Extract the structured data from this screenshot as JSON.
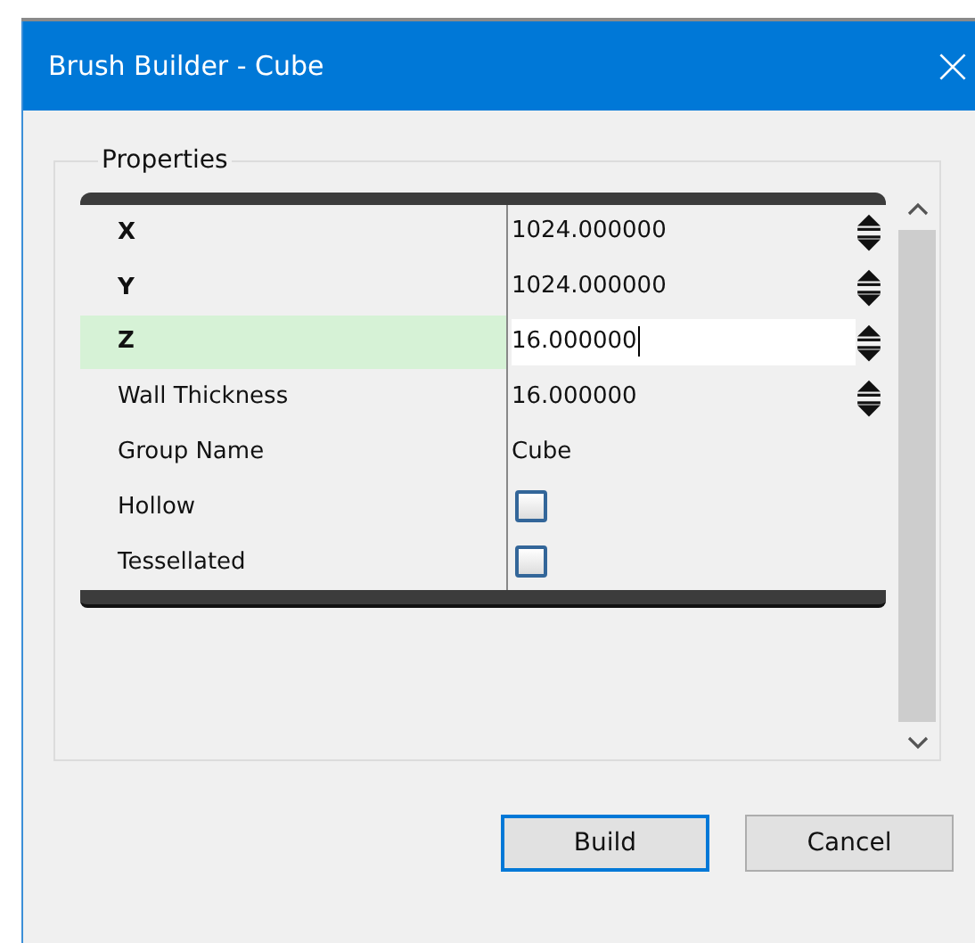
{
  "window": {
    "title": "Brush Builder - Cube"
  },
  "group": {
    "label": "Properties"
  },
  "properties": [
    {
      "name": "X",
      "kind": "number",
      "value": "1024.000000",
      "modified": true,
      "selected": false
    },
    {
      "name": "Y",
      "kind": "number",
      "value": "1024.000000",
      "modified": true,
      "selected": false
    },
    {
      "name": "Z",
      "kind": "number",
      "value": "16.000000",
      "modified": true,
      "selected": true
    },
    {
      "name": "Wall Thickness",
      "kind": "number",
      "value": "16.000000",
      "modified": false,
      "selected": false
    },
    {
      "name": "Group Name",
      "kind": "text",
      "value": "Cube",
      "modified": false,
      "selected": false
    },
    {
      "name": "Hollow",
      "kind": "checkbox",
      "checked": false,
      "modified": false,
      "selected": false
    },
    {
      "name": "Tessellated",
      "kind": "checkbox",
      "checked": false,
      "modified": false,
      "selected": false
    }
  ],
  "buttons": [
    {
      "label": "Build",
      "default": true
    },
    {
      "label": "Cancel",
      "default": false
    }
  ]
}
